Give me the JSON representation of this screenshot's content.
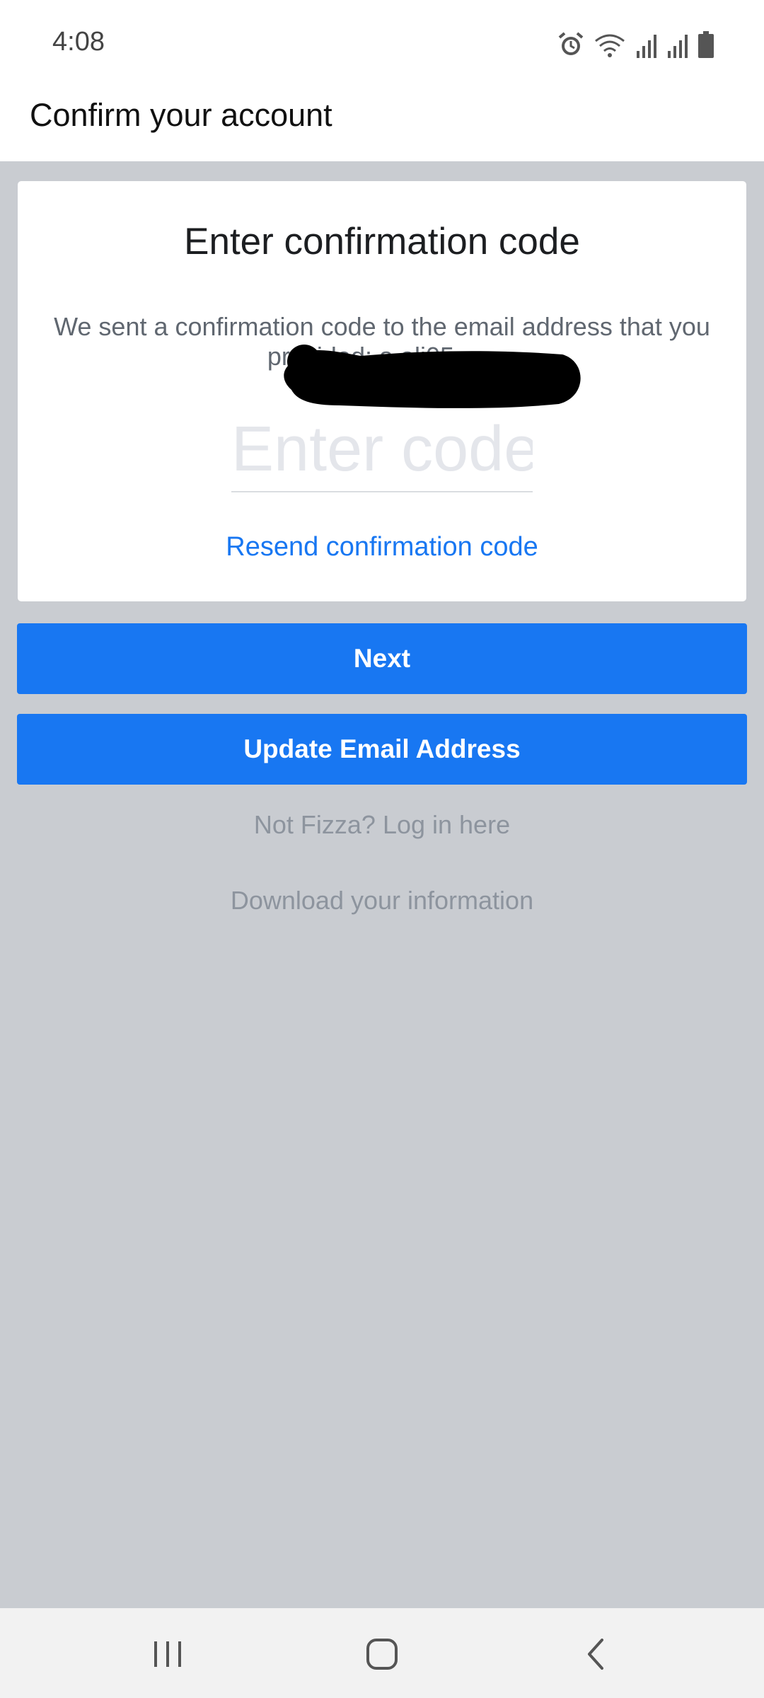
{
  "status_bar": {
    "time": "4:08",
    "icons": [
      "alarm-icon",
      "wifi-icon",
      "signal-icon",
      "signal-icon",
      "battery-icon"
    ]
  },
  "header": {
    "title": "Confirm your account"
  },
  "card": {
    "title": "Enter confirmation code",
    "description": "We sent a confirmation code to the email address that you provided: a        ali05                          om",
    "code_input": {
      "placeholder": "Enter code",
      "value": ""
    },
    "resend_label": "Resend confirmation code"
  },
  "actions": {
    "next_label": "Next",
    "update_email_label": "Update Email Address",
    "not_user_label": "Not Fizza? Log in here",
    "download_info_label": "Download your information"
  },
  "nav_bar": {
    "icons": [
      "recents-icon",
      "home-icon",
      "back-icon"
    ]
  },
  "colors": {
    "accent": "#1877f2",
    "background": "#c9ccd1",
    "muted_text": "#8d949e"
  }
}
